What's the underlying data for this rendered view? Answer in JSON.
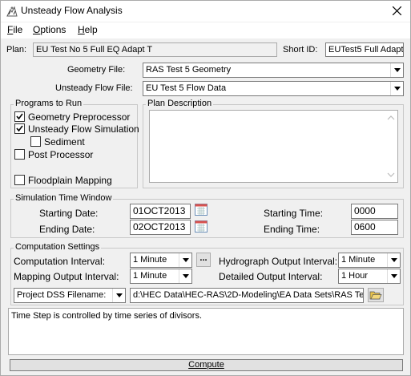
{
  "window": {
    "title": "Unsteady Flow Analysis"
  },
  "menu": {
    "file": "File",
    "options": "Options",
    "help": "Help"
  },
  "plan": {
    "label": "Plan:",
    "value": "EU Test No 5 Full EQ Adapt T",
    "short_id_label": "Short ID:",
    "short_id_value": "EUTest5 Full Adapt T"
  },
  "geometry": {
    "label": "Geometry File:",
    "value": "RAS Test 5 Geometry"
  },
  "unsteady": {
    "label": "Unsteady Flow File:",
    "value": "EU Test 5 Flow Data"
  },
  "programs": {
    "title": "Programs to Run",
    "items": [
      {
        "label": "Geometry Preprocessor",
        "checked": true
      },
      {
        "label": "Unsteady Flow Simulation",
        "checked": true
      },
      {
        "label": "Sediment",
        "checked": false
      },
      {
        "label": "Post Processor",
        "checked": false
      },
      {
        "label": "Floodplain Mapping",
        "checked": false
      }
    ]
  },
  "plan_description": {
    "title": "Plan Description",
    "value": ""
  },
  "sim_window": {
    "title": "Simulation Time Window",
    "start_date_label": "Starting Date:",
    "start_date": "01OCT2013",
    "end_date_label": "Ending Date:",
    "end_date": "02OCT2013",
    "start_time_label": "Starting Time:",
    "start_time": "0000",
    "end_time_label": "Ending Time:",
    "end_time": "0600"
  },
  "computation": {
    "title": "Computation Settings",
    "comp_interval_label": "Computation Interval:",
    "comp_interval": "1 Minute",
    "more_button": "...",
    "hydro_label": "Hydrograph Output Interval:",
    "hydro_interval": "1 Minute",
    "mapping_label": "Mapping Output Interval:",
    "mapping_interval": "1 Minute",
    "detailed_label": "Detailed Output Interval:",
    "detailed_interval": "1 Hour",
    "dss_label": "Project DSS Filename:",
    "dss_path": "d:\\HEC Data\\HEC-RAS\\2D-Modeling\\EA Data Sets\\RAS Test"
  },
  "message": "Time Step is controlled by time series of divisors.",
  "compute_button": "Compute",
  "colors": {
    "calendar_accent": "#d9534f",
    "folder_yellow": "#e8c24a"
  }
}
